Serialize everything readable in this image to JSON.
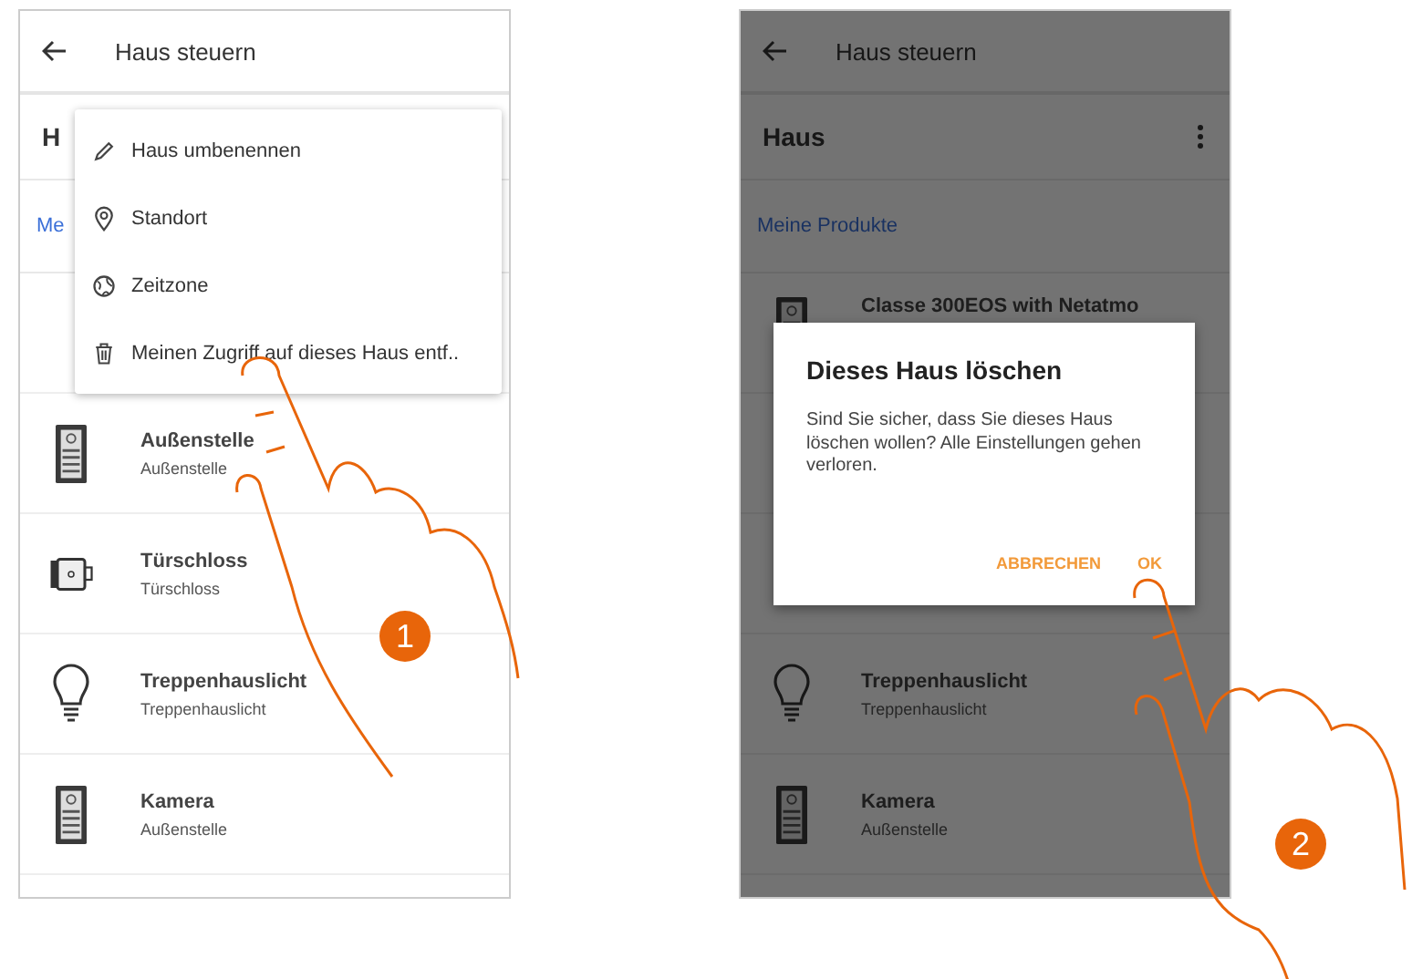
{
  "phones": [
    {
      "header": {
        "title": "Haus steuern"
      },
      "home": {
        "name": "H"
      },
      "section_link": "Me",
      "dimmed": false,
      "menu": {
        "items": [
          {
            "kind": "pencil",
            "label": "Haus umbenennen"
          },
          {
            "kind": "pin",
            "label": "Standort"
          },
          {
            "kind": "globe",
            "label": "Zeitzone"
          },
          {
            "kind": "trash",
            "label": "Meinen Zugriff auf dieses Haus entf.."
          }
        ]
      },
      "products": [
        {
          "kind": "door-station",
          "name": "Außenstelle",
          "type": "Außenstelle"
        },
        {
          "kind": "lock",
          "name": "Türschloss",
          "type": "Türschloss"
        },
        {
          "kind": "bulb",
          "name": "Treppenhauslicht",
          "type": "Treppenhauslicht"
        },
        {
          "kind": "door-station",
          "name": "Kamera",
          "type": "Außenstelle"
        }
      ],
      "badge": "1"
    },
    {
      "header": {
        "title": "Haus steuern"
      },
      "home": {
        "name": "Haus",
        "more_menu": true
      },
      "section_link": "Meine Produkte",
      "dimmed": true,
      "dialog": {
        "title": "Dieses Haus löschen",
        "message": "Sind Sie sicher, dass Sie dieses Haus löschen wollen? Alle Einstellungen gehen verloren.",
        "buttons": [
          "ABBRECHEN",
          "OK"
        ]
      },
      "products": [
        {
          "kind": "door-station",
          "name": "Classe 300EOS with Netatmo"
        },
        {
          "kind": "bulb",
          "name": "Treppenhauslicht",
          "type": "Treppenhauslicht"
        },
        {
          "kind": "door-station",
          "name": "Kamera",
          "type": "Außenstelle"
        }
      ],
      "badge": "2"
    }
  ]
}
